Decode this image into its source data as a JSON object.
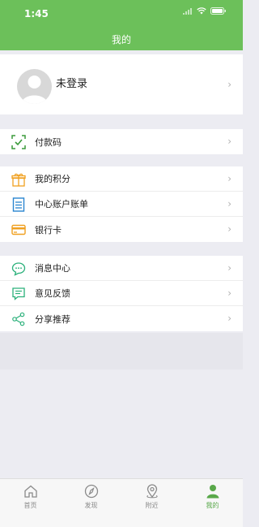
{
  "status": {
    "time": "1:45"
  },
  "nav": {
    "title": "我的"
  },
  "profile": {
    "name": "未登录"
  },
  "group1": [
    {
      "label": "付款码",
      "icon": "scan-check-icon"
    }
  ],
  "group2": [
    {
      "label": "我的积分",
      "icon": "gift-icon"
    },
    {
      "label": "中心账户账单",
      "icon": "bill-icon"
    },
    {
      "label": "银行卡",
      "icon": "bank-card-icon"
    }
  ],
  "group3": [
    {
      "label": "消息中心",
      "icon": "message-icon"
    },
    {
      "label": "意见反馈",
      "icon": "feedback-icon"
    },
    {
      "label": "分享推荐",
      "icon": "share-icon"
    }
  ],
  "tabs": [
    {
      "label": "首页",
      "icon": "home-icon",
      "active": false
    },
    {
      "label": "发现",
      "icon": "compass-icon",
      "active": false
    },
    {
      "label": "附近",
      "icon": "location-pin-icon",
      "active": false
    },
    {
      "label": "我的",
      "icon": "person-icon",
      "active": true
    }
  ],
  "colors": {
    "brand": "#6cc05a",
    "active_tab": "#59a84a"
  }
}
